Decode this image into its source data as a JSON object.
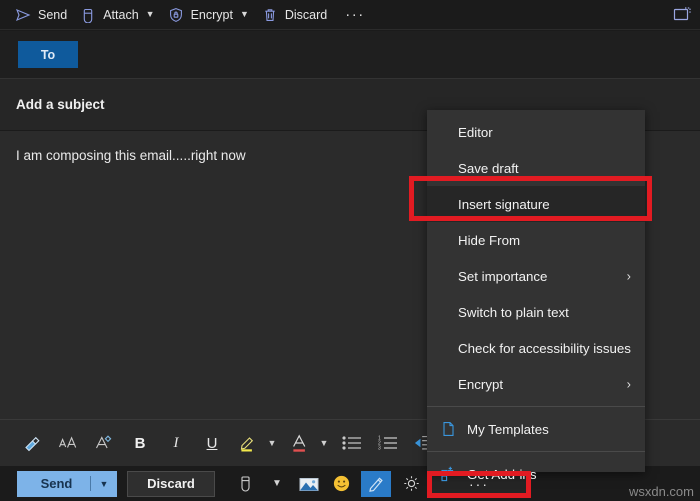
{
  "window": {
    "popout_icon": "pop-out-icon"
  },
  "command_bar": {
    "items": [
      {
        "label": "Send",
        "icon": "send-icon",
        "caret": false
      },
      {
        "label": "Attach",
        "icon": "attach-paperclip-icon",
        "caret": true
      },
      {
        "label": "Encrypt",
        "icon": "encrypt-shield-lock-icon",
        "caret": true
      },
      {
        "label": "Discard",
        "icon": "discard-trash-icon",
        "caret": false
      }
    ],
    "overflow_label": "···"
  },
  "compose": {
    "to_label": "To",
    "subject_placeholder": "Add a subject",
    "body_text": "I am composing this email.....right now"
  },
  "format_toolbar": {
    "items": [
      {
        "name": "format-painter-icon",
        "glyph": "✐"
      },
      {
        "name": "font-size-icon",
        "glyph": "AA"
      },
      {
        "name": "clear-formatting-icon",
        "glyph": "A"
      },
      {
        "name": "bold-icon",
        "glyph": "B"
      },
      {
        "name": "italic-icon",
        "glyph": "I"
      },
      {
        "name": "underline-icon",
        "glyph": "U"
      },
      {
        "name": "highlight-color-icon",
        "glyph": "✎"
      },
      {
        "name": "highlight-color-caret-icon",
        "glyph": "⌄"
      },
      {
        "name": "font-color-icon",
        "glyph": "A"
      },
      {
        "name": "font-color-caret-icon",
        "glyph": "⌄"
      },
      {
        "name": "bulleted-list-icon",
        "glyph": "☰"
      },
      {
        "name": "numbered-list-icon",
        "glyph": "☰"
      },
      {
        "name": "decrease-indent-icon",
        "glyph": "⇤"
      }
    ]
  },
  "bottom_bar": {
    "send_label": "Send",
    "send_caret": "⌄",
    "discard_label": "Discard",
    "icons": [
      {
        "name": "attach-paperclip-icon",
        "glyph": "📎"
      },
      {
        "name": "attach-caret-icon",
        "glyph": "⌄"
      },
      {
        "name": "insert-picture-icon",
        "glyph": "🖻"
      },
      {
        "name": "emoji-icon",
        "glyph": "🙂"
      },
      {
        "name": "insert-signature-icon",
        "glyph": "✍"
      },
      {
        "name": "suggestions-icon",
        "glyph": "☀"
      }
    ],
    "more_options_label": "···"
  },
  "context_menu": {
    "items": [
      {
        "label": "Editor",
        "submenu": false,
        "icon": null,
        "highlighted": false,
        "divider_before": false
      },
      {
        "label": "Save draft",
        "submenu": false,
        "icon": null,
        "highlighted": false,
        "divider_before": false
      },
      {
        "label": "Insert signature",
        "submenu": false,
        "icon": null,
        "highlighted": true,
        "divider_before": false
      },
      {
        "label": "Hide From",
        "submenu": false,
        "icon": null,
        "highlighted": false,
        "divider_before": false
      },
      {
        "label": "Set importance",
        "submenu": true,
        "icon": null,
        "highlighted": false,
        "divider_before": false
      },
      {
        "label": "Switch to plain text",
        "submenu": false,
        "icon": null,
        "highlighted": false,
        "divider_before": false
      },
      {
        "label": "Check for accessibility issues",
        "submenu": false,
        "icon": null,
        "highlighted": false,
        "divider_before": false
      },
      {
        "label": "Encrypt",
        "submenu": true,
        "icon": null,
        "highlighted": false,
        "divider_before": false
      },
      {
        "label": "My Templates",
        "submenu": false,
        "icon": "my-templates-icon",
        "highlighted": false,
        "divider_before": true
      },
      {
        "label": "Get Add-ins",
        "submenu": false,
        "icon": "get-addins-icon",
        "highlighted": false,
        "divider_before": true
      }
    ],
    "submenu_arrow": "›"
  },
  "annotations": {
    "highlight_color": "#e21b22",
    "menu_item_box_target": "Insert signature",
    "button_box_target": "More options"
  },
  "watermark": {
    "text": "wsxdn.com"
  },
  "colors": {
    "accent_blue": "#0f5a9c",
    "send_button": "#7db3e8",
    "menu_bg": "#333333",
    "body_bg": "#2b2b2b",
    "chrome_bg": "#1b1b1b",
    "icon_blue": "#3a96dd"
  }
}
